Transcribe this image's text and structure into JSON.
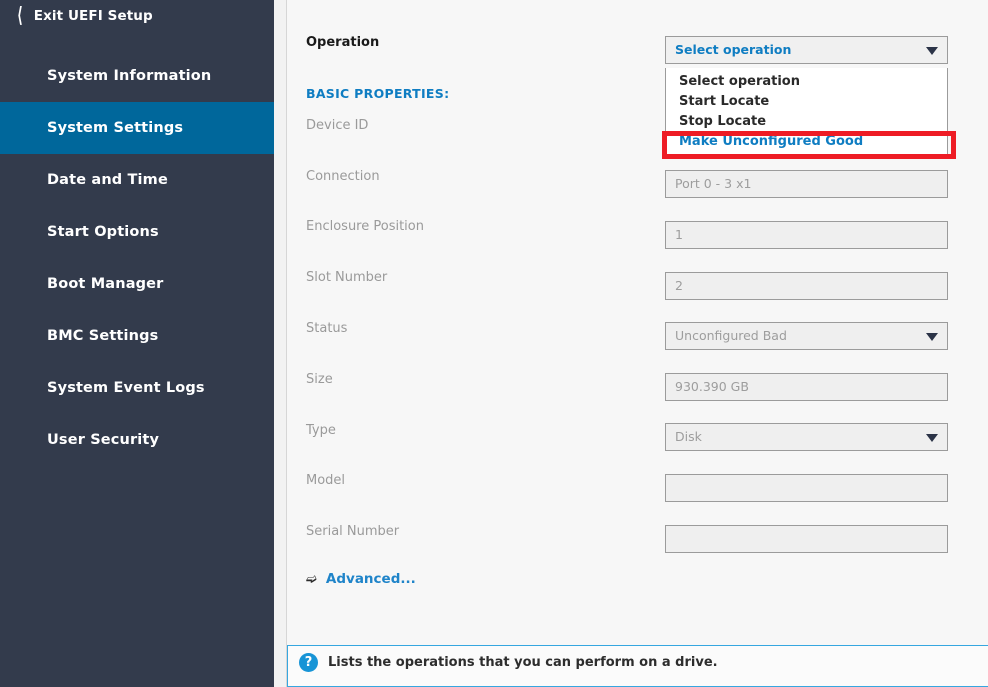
{
  "sidebar": {
    "exit": {
      "chevron_icon": "chevron-left-icon",
      "label": "Exit UEFI Setup"
    },
    "items": [
      {
        "label": "System Information",
        "active": false
      },
      {
        "label": "System Settings",
        "active": true
      },
      {
        "label": "Date and Time",
        "active": false
      },
      {
        "label": "Start Options",
        "active": false
      },
      {
        "label": "Boot Manager",
        "active": false
      },
      {
        "label": "BMC Settings",
        "active": false
      },
      {
        "label": "System Event Logs",
        "active": false
      },
      {
        "label": "User Security",
        "active": false
      }
    ]
  },
  "main": {
    "operation_label": "Operation",
    "operation_value": "Select operation",
    "section_header": "BASIC PROPERTIES:",
    "fields": [
      {
        "label": "Device ID",
        "value": "",
        "type": "text"
      },
      {
        "label": "Connection",
        "value": "Port 0 - 3 x1",
        "type": "text"
      },
      {
        "label": "Enclosure Position",
        "value": "1",
        "type": "text"
      },
      {
        "label": "Slot Number",
        "value": "2",
        "type": "text"
      },
      {
        "label": "Status",
        "value": "Unconfigured Bad",
        "type": "select"
      },
      {
        "label": "Size",
        "value": "930.390 GB",
        "type": "text"
      },
      {
        "label": "Type",
        "value": "Disk",
        "type": "select"
      },
      {
        "label": "Model",
        "value": "",
        "type": "text"
      },
      {
        "label": "Serial Number",
        "value": "",
        "type": "text"
      }
    ],
    "advanced": {
      "arrow_icon": "arrow-right-icon",
      "label": "Advanced..."
    }
  },
  "dropdown": {
    "open": true,
    "options": [
      {
        "label": "Select operation",
        "selected": false
      },
      {
        "label": "Start Locate",
        "selected": false
      },
      {
        "label": "Stop Locate",
        "selected": false
      },
      {
        "label": "Make Unconfigured Good",
        "selected": true
      }
    ]
  },
  "help": {
    "icon": "question-mark-icon",
    "text": "Lists the operations that you can perform on a drive."
  },
  "colors": {
    "sidebar_bg": "#333b4c",
    "sidebar_active": "#00679b",
    "accent_blue": "#0f7dc2",
    "annotation_red": "#ee1c25",
    "help_border": "#36a7e0"
  }
}
